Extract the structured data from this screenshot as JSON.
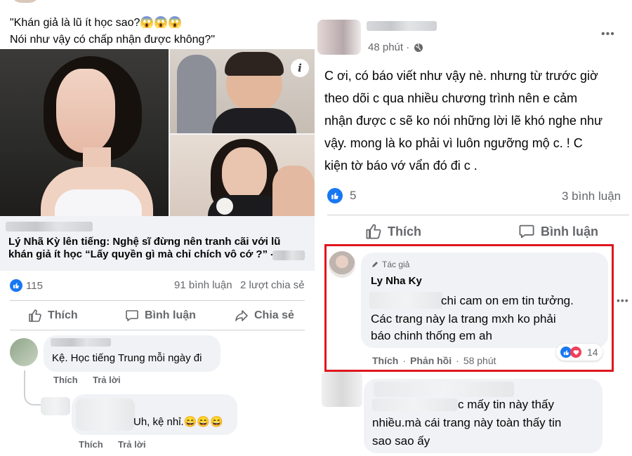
{
  "left": {
    "caption_line1": "\"Khán giả là lũ ít học sao?😱😱😱",
    "caption_line2": "Nói như vậy có chấp nhận được không?\"",
    "info_icon_glyph": "i",
    "article_title": "Lý Nhã Kỳ lên tiếng: Nghệ sĩ đừng nên tranh cãi với lũ khán giả ít học “Lấy quyền gì mà chỉ chích vô cớ ?” -",
    "reaction_count": "115",
    "comment_count": "91 bình luận",
    "share_count": "2 lượt chia sẻ",
    "actions": {
      "like": "Thích",
      "comment": "Bình luận",
      "share": "Chia sẻ"
    },
    "comments": [
      {
        "text": "Kệ. Học tiếng Trung mỗi ngày đi",
        "like": "Thích",
        "reply": "Trả lời"
      },
      {
        "text": "Uh, kệ nhỉ.😄😄😄",
        "like": "Thích",
        "reply": "Trả lời"
      }
    ]
  },
  "right": {
    "post_time": "48 phút ·",
    "post_text_lines": [
      "C ơi, có báo viết như vậy nè. nhưng từ trước giờ",
      "theo dõi c qua nhiều chương trình nên e cảm",
      "nhận được c sẽ ko nói những lời lẽ khó nghe như",
      "vậy. mong là ko phải vì luôn ngưỡng mộ c. ! C",
      "kiện tờ báo vớ vẩn đó đi c ."
    ],
    "reaction_count": "5",
    "comment_count": "3 bình luận",
    "actions": {
      "like": "Thích",
      "comment": "Bình luận"
    },
    "author_reply": {
      "badge": "Tác giả",
      "name": "Ly Nha Ky",
      "line1": "chi cam on em tin tưởng.",
      "line2": "Các trang này la trang mxh ko phải",
      "line3": "báo chinh thống em ah",
      "reaction_count": "14",
      "like": "Thích",
      "reply": "Phản hồi",
      "time": "58 phút"
    },
    "more_options": "•••",
    "last_comment_lines": [
      "c mấy tin này thấy",
      "nhiều.mà cái trang này toàn thấy tin",
      "sao sao ấy"
    ]
  },
  "colors": {
    "highlight_border": "#e0161e",
    "facebook_blue": "#1877f2",
    "love_red": "#f33e58"
  }
}
